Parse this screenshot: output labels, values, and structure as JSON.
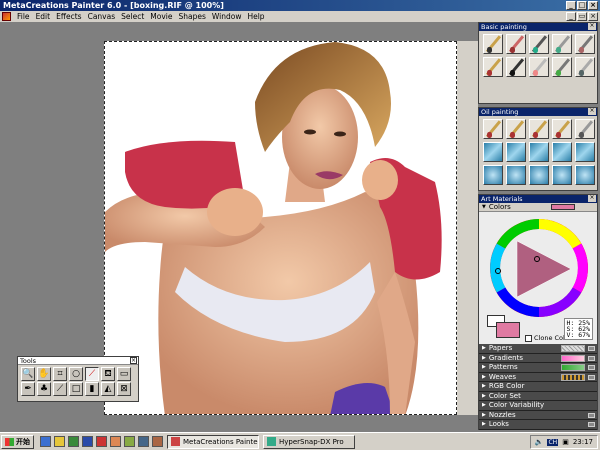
{
  "window": {
    "title": "MetaCreations Painter 6.0 - [boxing.RIF @ 100%]"
  },
  "menu": [
    "File",
    "Edit",
    "Effects",
    "Canvas",
    "Select",
    "Movie",
    "Shapes",
    "Window",
    "Help"
  ],
  "tools_palette": {
    "title": "Tools"
  },
  "basic_painting": {
    "title": "Basic painting"
  },
  "oil_painting": {
    "title": "Oil painting"
  },
  "art_materials": {
    "title": "Art Materials",
    "colors_label": "Colors",
    "current_color": "#e07aa2",
    "hsv": {
      "h": "H: 25%",
      "s": "S: 62%",
      "v": "V: 67%"
    },
    "clone_color_label": "Clone Color",
    "sections": [
      "Papers",
      "Gradients",
      "Patterns",
      "Weaves",
      "RGB Color",
      "Color Set",
      "Color Variability",
      "Nozzles",
      "Looks"
    ]
  },
  "taskbar": {
    "start_label": "开始",
    "tasks": [
      "MetaCreations Painter 6....",
      "HyperSnap-DX Pro"
    ],
    "tray_lang": "CH",
    "clock": "23:17"
  },
  "colors": {
    "title_bar": "#0a246a",
    "accent_pink": "#e07aa2"
  }
}
